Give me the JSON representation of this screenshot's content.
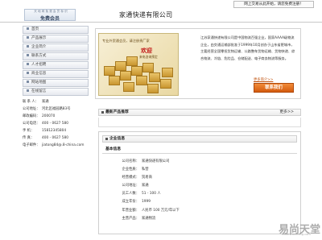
{
  "topbar": {
    "login_text": "网上交易从此开始，请您免费注册！"
  },
  "header": {
    "member_small": "天 地 网 免 费 会 员 标 识",
    "member_label": "免费会员",
    "company_name": "家通快递有限公司"
  },
  "nav": {
    "items": [
      {
        "label": "首页"
      },
      {
        "label": "产品展示"
      },
      {
        "label": "企业简介"
      },
      {
        "label": "联系方式"
      },
      {
        "label": "人才招聘"
      },
      {
        "label": "商业信息"
      },
      {
        "label": "网站地图"
      },
      {
        "label": "在线留言"
      }
    ]
  },
  "contact": {
    "rows": [
      {
        "label": "联 系 人：",
        "value": "家通"
      },
      {
        "label": "公司地址：",
        "value": "河北区福园路83号"
      },
      {
        "label": "邮政编码：",
        "value": "200070"
      },
      {
        "label": "公司电话：",
        "value": "400 - 0627 580"
      },
      {
        "label": "手    机：",
        "value": "15812345804"
      },
      {
        "label": "传    真：",
        "value": "400 - 0627 580"
      },
      {
        "label": "电子邮件：",
        "value": "jiatong84@.8-china.com"
      }
    ]
  },
  "banner": {
    "caption_top": "专业外贸通会员，请注册贵厂家",
    "welcome": "欢迎",
    "caption_sub": "来电咨询预定",
    "intro": "江苏家通快递有限公司是中国物流百强企业，国家AAAA级物流企业，由交通运输部批准于1999年10月创办于山东省肥城市，主要经营全国零担货物运输、公路整车货物运输、货物快递、综合物流、冷链、危险品、仓储配送、电子商务物流等服务。",
    "more_link": "更多简介>>",
    "contact_button": "联系我们"
  },
  "products": {
    "title": "最新产品推荐",
    "more": "更多>>"
  },
  "company_info": {
    "title": "企业信息",
    "sub_title": "基本信息",
    "rows": [
      {
        "key": "公司名称：",
        "value": "家通快递有限公司"
      },
      {
        "key": "企业性质：",
        "value": "私营"
      },
      {
        "key": "经营模式：",
        "value": "贸易商"
      },
      {
        "key": "公司地址：",
        "value": "家通"
      },
      {
        "key": "员工人数：",
        "value": "51 - 100 人"
      },
      {
        "key": "成立年份：",
        "value": "1999"
      },
      {
        "key": "年营业额：",
        "value": "人民币 100 万元/年以下"
      },
      {
        "key": "主营产品：",
        "value": "家通物流"
      }
    ]
  },
  "watermark": {
    "text": "易尚天堂",
    "sub": "www.wtoshang.com"
  }
}
